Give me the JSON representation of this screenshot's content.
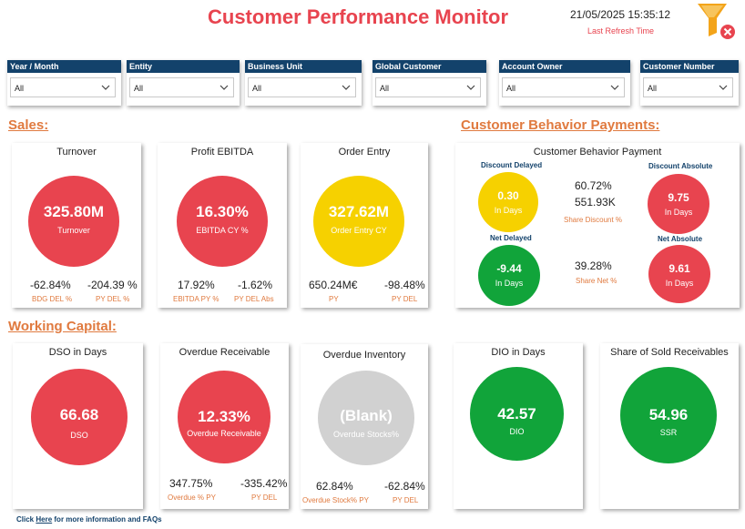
{
  "header": {
    "title": "Customer Performance Monitor",
    "refresh_datetime": "21/05/2025 15:35:12",
    "refresh_label": "Last Refresh Time"
  },
  "filters": [
    {
      "label": "Year / Month",
      "value": "All"
    },
    {
      "label": "Entity",
      "value": "All"
    },
    {
      "label": "Business Unit",
      "value": "All"
    },
    {
      "label": "Global Customer",
      "value": "All"
    },
    {
      "label": "Account Owner",
      "value": "All"
    },
    {
      "label": "Customer Number",
      "value": "All"
    }
  ],
  "sections": {
    "sales": "Sales:",
    "customer_behavior": "Customer Behavior Payments:",
    "working_capital": "Working Capital:"
  },
  "sales": {
    "turnover": {
      "title": "Turnover",
      "value": "325.80M",
      "label": "Turnover",
      "stat1_value": "-62.84%",
      "stat1_label": "BDG DEL %",
      "stat2_value": "-204.39 %",
      "stat2_label": "PY DEL %"
    },
    "ebitda": {
      "title": "Profit EBITDA",
      "value": "16.30%",
      "label": "EBITDA CY %",
      "stat1_value": "17.92%",
      "stat1_label": "EBITDA PY %",
      "stat2_value": "-1.62%",
      "stat2_label": "PY DEL Abs"
    },
    "order_entry": {
      "title": "Order Entry",
      "value": "327.62M",
      "label": "Order Entry CY",
      "stat1_value": "650.24M€",
      "stat1_label": "PY",
      "stat2_value": "-98.48%",
      "stat2_label": "PY DEL"
    }
  },
  "behavior": {
    "title": "Customer Behavior Payment",
    "discount_delayed": {
      "header": "Discount Delayed",
      "value": "0.30",
      "label": "In Days"
    },
    "discount_absolute": {
      "header": "Discount Absolute",
      "value": "9.75",
      "label": "In Days"
    },
    "share_discount": {
      "pct": "60.72%",
      "amount": "551.93K",
      "label": "Share Discount %"
    },
    "net_delayed": {
      "header": "Net Delayed",
      "value": "-9.44",
      "label": "In Days"
    },
    "net_absolute": {
      "header": "Net Absolute",
      "value": "9.61",
      "label": "In Days"
    },
    "share_net": {
      "pct": "39.28%",
      "label": "Share Net %"
    }
  },
  "working_capital": {
    "dso": {
      "title": "DSO in Days",
      "value": "66.68",
      "label": "DSO"
    },
    "overdue_receivable": {
      "title": "Overdue Receivable",
      "value": "12.33%",
      "label": "Overdue Receivable",
      "stat1_value": "347.75%",
      "stat1_label": "Overdue % PY",
      "stat2_value": "-335.42%",
      "stat2_label": "PY DEL"
    },
    "overdue_inventory": {
      "title": "Overdue Inventory",
      "value": "(Blank)",
      "label": "Overdue Stocks%",
      "stat1_value": "62.84%",
      "stat1_label": "Overdue Stock% PY",
      "stat2_value": "-62.84%",
      "stat2_label": "PY DEL"
    },
    "dio": {
      "title": "DIO in Days",
      "value": "42.57",
      "label": "DIO"
    },
    "ssr": {
      "title": "Share of Sold Receivables",
      "value": "54.96",
      "label": "SSR"
    }
  },
  "footer": {
    "prefix": "Click",
    "link": "Here",
    "suffix": "for more information and FAQs"
  },
  "colors": {
    "red": "#e8444f",
    "yellow": "#f6d100",
    "green": "#11a43a",
    "grey": "#d1d1d1",
    "navy": "#13426b",
    "orange": "#e07a3f"
  },
  "icons": [
    "clear-filters-funnel-icon",
    "chevron-down-icon"
  ]
}
